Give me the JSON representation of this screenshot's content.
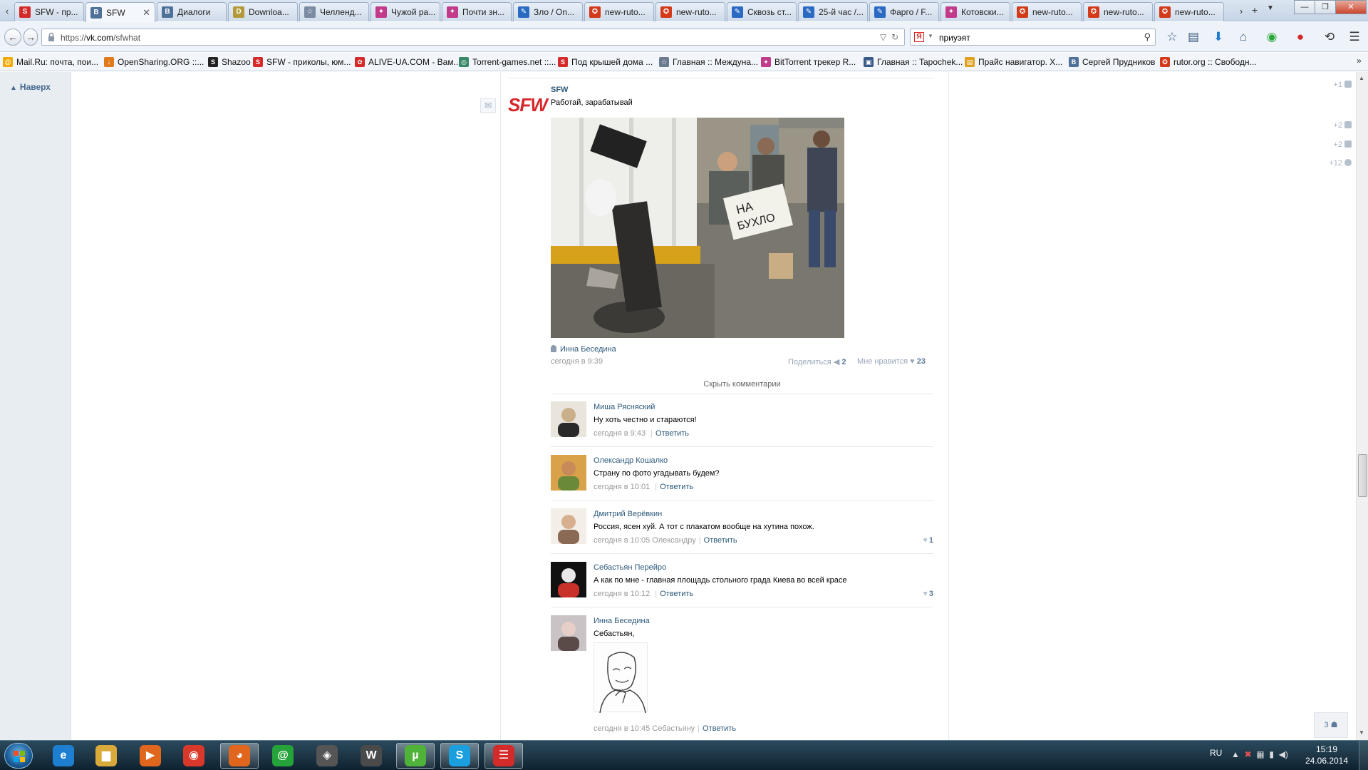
{
  "browser": {
    "tabs": [
      {
        "title": "SFW - пр...",
        "color": "#d52a2a",
        "glyph": "S"
      },
      {
        "title": "SFW",
        "color": "#4d7198",
        "glyph": "В",
        "active": true
      },
      {
        "title": "Диалоги",
        "color": "#4d7198",
        "glyph": "В"
      },
      {
        "title": "Downloa...",
        "color": "#b29a3a",
        "glyph": "D"
      },
      {
        "title": "Челленд...",
        "color": "#7a8aa0",
        "glyph": "☆"
      },
      {
        "title": "Чужой ра...",
        "color": "#c23a8a",
        "glyph": "✦"
      },
      {
        "title": "Почти зн...",
        "color": "#c23a8a",
        "glyph": "✦"
      },
      {
        "title": "Зло / On...",
        "color": "#2a6ac2",
        "glyph": "✎"
      },
      {
        "title": "new-ruto...",
        "color": "#d23a1a",
        "glyph": "✪"
      },
      {
        "title": "new-ruto...",
        "color": "#d23a1a",
        "glyph": "✪"
      },
      {
        "title": "Сквозь ст...",
        "color": "#2a6ac2",
        "glyph": "✎"
      },
      {
        "title": "25-й час /...",
        "color": "#2a6ac2",
        "glyph": "✎"
      },
      {
        "title": "Фарго / F...",
        "color": "#2a6ac2",
        "glyph": "✎"
      },
      {
        "title": "Котовски...",
        "color": "#c23a8a",
        "glyph": "✦"
      },
      {
        "title": "new-ruto...",
        "color": "#d23a1a",
        "glyph": "✪"
      },
      {
        "title": "new-ruto...",
        "color": "#d23a1a",
        "glyph": "✪"
      },
      {
        "title": "new-ruto...",
        "color": "#d23a1a",
        "glyph": "✪"
      }
    ],
    "url_prefix": "https://",
    "url_host": "vk.com",
    "url_path": "/sfwhat",
    "search_value": "приуэят",
    "bookmarks": [
      {
        "label": "Mail.Ru: почта, пои...",
        "color": "#f2a900",
        "glyph": "@"
      },
      {
        "label": "OpenSharing.ORG ::...",
        "color": "#e07a1a",
        "glyph": "↓"
      },
      {
        "label": "Shazoo",
        "color": "#222222",
        "glyph": "S"
      },
      {
        "label": "SFW - приколы, юм...",
        "color": "#d52a2a",
        "glyph": "S"
      },
      {
        "label": "ALIVE-UA.COM - Вам...",
        "color": "#d52a2a",
        "glyph": "✿"
      },
      {
        "label": "Torrent-games.net ::...",
        "color": "#3a8a6a",
        "glyph": "◎"
      },
      {
        "label": "Под крышей дома ...",
        "color": "#d52a2a",
        "glyph": "S"
      },
      {
        "label": "Главная :: Междуна...",
        "color": "#6a7a90",
        "glyph": "☆"
      },
      {
        "label": "BitTorrent трекер R...",
        "color": "#c23a8a",
        "glyph": "✦"
      },
      {
        "label": "Главная :: Tapochek...",
        "color": "#3a5a8a",
        "glyph": "▣"
      },
      {
        "label": "Прайс навигатор. Х...",
        "color": "#e0a020",
        "glyph": "▤"
      },
      {
        "label": "Сергей Прудников",
        "color": "#4d7198",
        "glyph": "В"
      },
      {
        "label": "rutor.org :: Свободн...",
        "color": "#d23a1a",
        "glyph": "✪"
      }
    ]
  },
  "page": {
    "to_top": "Наверх",
    "actions": {
      "share_count": "+1",
      "friends_count": "+2",
      "comments_count": "+2",
      "settings_count": "+12"
    },
    "post": {
      "logo_text": "SFW",
      "author": "SFW",
      "text": "Работай, зарабатывай",
      "photo_sign": "НА БУХЛО",
      "signer": "Инна Беседина",
      "time": "сегодня в 9:39",
      "share_label": "Поделиться",
      "share_count": "2",
      "like_label": "Мне нравится",
      "like_count": "23",
      "hide_comments": "Скрыть комментарии"
    },
    "comments": [
      {
        "name": "Миша Рясняский",
        "text": "Ну хоть честно и стараются!",
        "time": "сегодня в 9:43",
        "to": "",
        "reply": "Ответить",
        "likes": ""
      },
      {
        "name": "Олександр Кошалко",
        "text": "Страну по фото угадывать будем?",
        "time": "сегодня в 10:01",
        "to": "",
        "reply": "Ответить",
        "likes": ""
      },
      {
        "name": "Дмитрий Верёвкин",
        "text": "Россия, ясен хуй. А тот с плакатом вообще на хутина похож.",
        "time": "сегодня в 10:05",
        "to": "Олександру",
        "reply": "Ответить",
        "likes": "1"
      },
      {
        "name": "Себастьян Перейро",
        "text": "А как по мне - главная площадь стольного града Киева во всей красе",
        "time": "сегодня в 10:12",
        "to": "",
        "reply": "Ответить",
        "likes": "3"
      },
      {
        "name": "Инна Беседина",
        "text": "Себастьян,",
        "time": "сегодня в 10:45",
        "to": "Себастьяну",
        "reply": "Ответить",
        "likes": ""
      }
    ],
    "online_counter": "3"
  },
  "taskbar": {
    "apps": [
      {
        "name": "ie",
        "color": "#1e7fd0",
        "glyph": "e"
      },
      {
        "name": "explorer",
        "color": "#d9a93a",
        "glyph": "▆"
      },
      {
        "name": "media-player",
        "color": "#e0661e",
        "glyph": "▶"
      },
      {
        "name": "chrome",
        "color": "#d8392a",
        "glyph": "◉"
      },
      {
        "name": "firefox",
        "color": "#e0661e",
        "glyph": "◕",
        "active": true
      },
      {
        "name": "mail-agent",
        "color": "#25a33a",
        "glyph": "@"
      },
      {
        "name": "game-center",
        "color": "#555555",
        "glyph": "◈"
      },
      {
        "name": "world-of-tanks",
        "color": "#4a4a4a",
        "glyph": "W"
      },
      {
        "name": "utorrent",
        "color": "#4fb33a",
        "glyph": "µ",
        "active": true
      },
      {
        "name": "skype",
        "color": "#1aa0de",
        "glyph": "S",
        "active": true
      },
      {
        "name": "rutracker",
        "color": "#d32a2a",
        "glyph": "☰",
        "active": true
      }
    ],
    "lang": "RU",
    "time": "15:19",
    "date": "24.06.2014"
  }
}
